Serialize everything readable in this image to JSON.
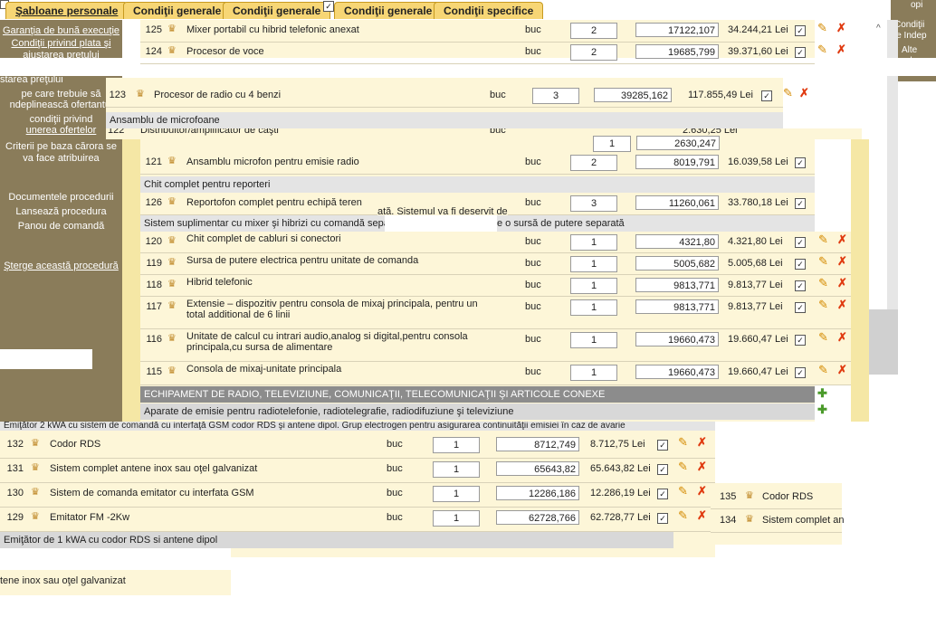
{
  "tabs": [
    {
      "label": "Şabloane personale",
      "active": true
    },
    {
      "label": "Condiţii generale",
      "active": false
    },
    {
      "label": "Condiţii generale",
      "active": false
    },
    {
      "label": "Condiţii generale",
      "active": false
    },
    {
      "label": "Condiţii specifice",
      "active": false
    }
  ],
  "tab_check": "✓",
  "left_menu": [
    {
      "label": "Garanţia de bună execuţie"
    },
    {
      "label": "Condiţii privind plata şi ajustarea preţului"
    },
    {
      "label": "starea preţului"
    },
    {
      "label": "pe care trebuie să"
    },
    {
      "label": "ndeplinească ofertantul"
    },
    {
      "label": "condiţii privind"
    },
    {
      "label": "unerea ofertelor"
    },
    {
      "label": "Criterii pe baza cărora se va face atribuirea"
    },
    {
      "label": "Documentele procedurii"
    },
    {
      "label": "Lansează procedura"
    },
    {
      "label": "Panou de comandă"
    },
    {
      "label": "Şterge această procedură"
    }
  ],
  "right_panel": {
    "lines": [
      "Condiţii",
      "le Indep",
      "Alte",
      "dep",
      "opi"
    ]
  },
  "scroll_arrow": "^",
  "icons": {
    "user": "user-group-icon",
    "edit": "edit-icon",
    "delete": "delete-icon",
    "add": "add-icon",
    "check": "✓"
  },
  "top_rows": [
    {
      "nr": "125",
      "name": "Mixer portabil cu hibrid telefonic anexat",
      "unit": "buc",
      "qty": "2",
      "price": "17122,107",
      "total": "34.244,21 Lei"
    },
    {
      "nr": "124",
      "name": "Procesor de voce",
      "unit": "buc",
      "qty": "2",
      "price": "19685,799",
      "total": "39.371,60 Lei"
    }
  ],
  "mid_row": {
    "nr": "123",
    "name": "Procesor de radio cu 4 benzi",
    "unit": "buc",
    "qty": "3",
    "price": "39285,162",
    "total": "117.855,49 Lei"
  },
  "group_microfoane": "Ansamblu de microfoane",
  "overlap_row": {
    "nr": "122",
    "name": "Distribuitor/amplificator de căşti",
    "unit": "buc",
    "qty": "1",
    "price": "2630,247",
    "total": "2.630,25 Lei"
  },
  "row_121": {
    "nr": "121",
    "name": "Ansamblu microfon pentru emisie radio",
    "unit": "buc",
    "qty": "2",
    "price": "8019,791",
    "total": "16.039,58 Lei"
  },
  "group_chit": "Chit complet pentru reporteri",
  "row_126": {
    "nr": "126",
    "name": "Reportofon complet pentru echipă teren",
    "unit": "buc",
    "qty": "3",
    "price": "11260,061",
    "total": "33.780,18 Lei"
  },
  "row_126_overlay": "ată. Sistemul va fi deservit de",
  "group_sistem": "Sistem suplimentar cu mixer şi hibrizi cu comandă separa",
  "group_sistem_tail": "e o sursă de putere separată",
  "rows_main": [
    {
      "nr": "120",
      "name": "Chit complet de cabluri si conectori",
      "unit": "buc",
      "qty": "1",
      "price": "4321,80",
      "total": "4.321,80 Lei"
    },
    {
      "nr": "119",
      "name": "Sursa de putere electrica pentru unitate de comanda",
      "unit": "buc",
      "qty": "1",
      "price": "5005,682",
      "total": "5.005,68 Lei"
    },
    {
      "nr": "118",
      "name": "Hibrid telefonic",
      "unit": "buc",
      "qty": "1",
      "price": "9813,771",
      "total": "9.813,77 Lei"
    },
    {
      "nr": "117",
      "name": "Extensie – dispozitiv pentru consola de mixaj principala, pentru un total additional de 6 linii",
      "unit": "buc",
      "qty": "1",
      "price": "9813,771",
      "total": "9.813,77 Lei"
    },
    {
      "nr": "116",
      "name": "Unitate de calcul cu intrari audio,analog si digital,pentru consola principala,cu sursa de alimentare",
      "unit": "buc",
      "qty": "1",
      "price": "19660,473",
      "total": "19.660,47 Lei"
    },
    {
      "nr": "115",
      "name": "Consola de mixaj-unitate principala",
      "unit": "buc",
      "qty": "1",
      "price": "19660,473",
      "total": "19.660,47 Lei"
    }
  ],
  "group_echipament": "ECHIPAMENT DE RADIO, TELEVIZIUNE, COMUNICAŢII, TELECOMUNICAŢII ŞI ARTICOLE CONEXE",
  "group_aparate": "Aparate de emisie pentru radiotelefonie, radiotelegrafie, radiodifuziune şi televiziune",
  "group_emitator2": "Emiţător 2 kWA cu sistem de comandă cu interfaţă GSM codor RDS şi antene dipol. Grup electrogen pentru asigurarea continuităţii emisiei în caz de avarie",
  "bottom_rows": [
    {
      "nr": "132",
      "name": "Codor RDS",
      "unit": "buc",
      "qty": "1",
      "price": "8712,749",
      "total": "8.712,75 Lei"
    },
    {
      "nr": "131",
      "name": "Sistem complet antene inox sau oţel galvanizat",
      "unit": "buc",
      "qty": "1",
      "price": "65643,82",
      "total": "65.643,82 Lei"
    },
    {
      "nr": "130",
      "name": "Sistem de comanda emitator cu interfata GSM",
      "unit": "buc",
      "qty": "1",
      "price": "12286,186",
      "total": "12.286,19 Lei"
    },
    {
      "nr": "129",
      "name": "Emitator FM -2Kw",
      "unit": "buc",
      "qty": "1",
      "price": "62728,766",
      "total": "62.728,77 Lei"
    }
  ],
  "group_emitator1": "Emiţător de 1 kWA cu codor RDS si antene dipol",
  "bottom_fragment": "tene inox sau oţel galvanizat",
  "side_rows": [
    {
      "nr": "135",
      "name": "Codor RDS"
    },
    {
      "nr": "134",
      "name": "Sistem complet an"
    }
  ]
}
